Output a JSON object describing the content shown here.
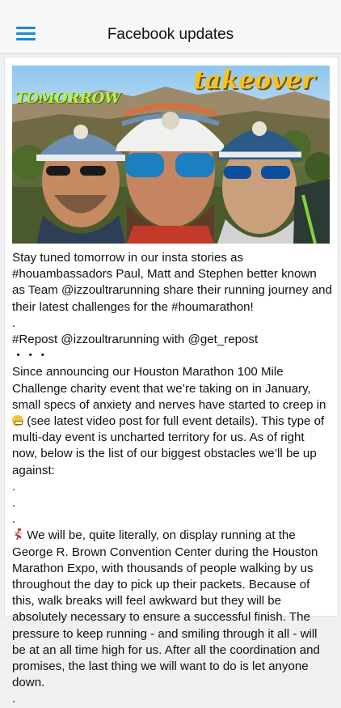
{
  "header": {
    "title": "Facebook updates",
    "menu_icon": "hamburger-menu-icon"
  },
  "post": {
    "image": {
      "overlay_left": "TOMORROW",
      "overlay_right": "takeover"
    },
    "paragraphs": [
      "Stay tuned tomorrow in our insta stories as #houambassadors Paul, Matt and Stephen better known as Team @izzoultrarunning share their running journey and their latest challenges for the #houmarathon!",
      ".",
      "#Repost @izzoultrarunning with @get_repost",
      "・・・",
      "Since announcing our Houston Marathon 100 Mile Challenge charity event that we’re taking on in January, small specs of anxiety and nerves have started to creep in",
      "(see latest video post for full event details). This type of multi-day event is uncharted territory for us. As of right now, below is the list of our biggest obstacles we’ll be up against:",
      ".",
      ".",
      ".",
      "We will be, quite literally, on display running at the George R. Brown Convention Center during the Houston Marathon Expo, with thousands of people walking by us throughout the day to pick up their packets. Because of this, walk breaks will feel awkward but they will be absolutely necessary to ensure a successful finish. The pressure to keep running - and smiling through it all -  will be at an all time high for us. After all the coordination and promises, the last thing we will want to do is let anyone down.",
      "."
    ],
    "emoji_icons": [
      "grimacing-face-icon",
      "runner-icon"
    ]
  }
}
